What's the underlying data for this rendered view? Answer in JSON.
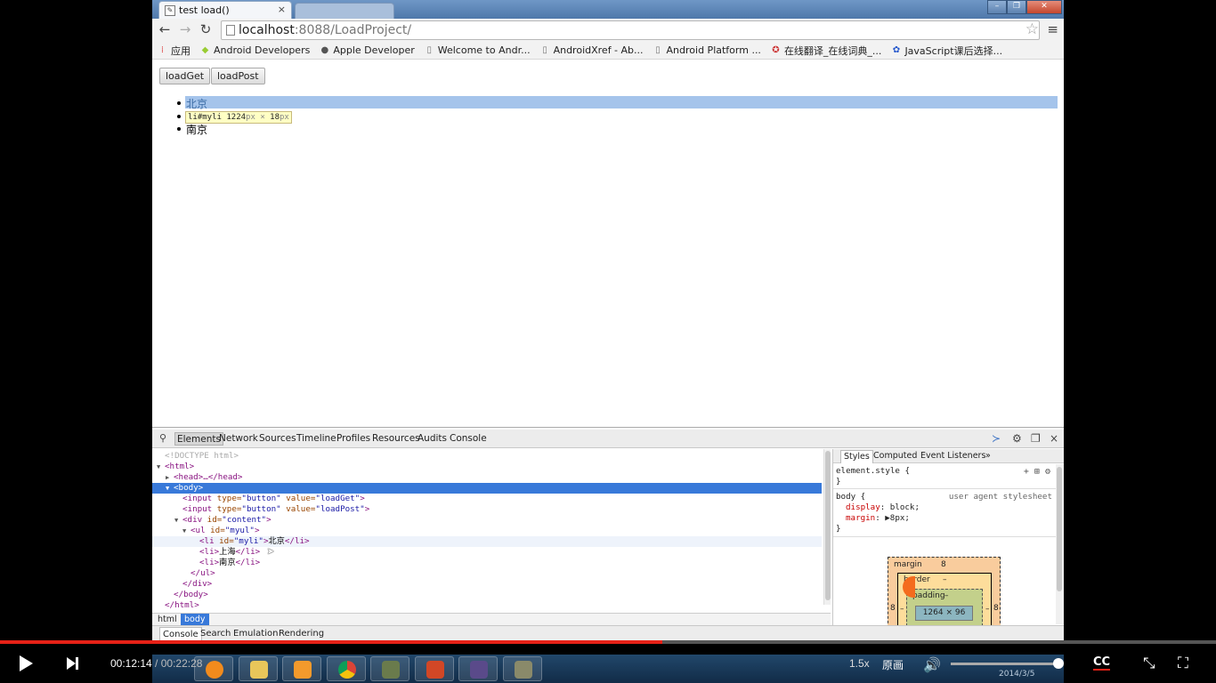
{
  "browser": {
    "tab_title": "test load()",
    "tab_close": "×",
    "window_controls": {
      "minimize": "–",
      "restore": "❐",
      "close": "✕"
    },
    "url_host": "localhost",
    "url_rest": ":8088/LoadProject/",
    "bookmarks": [
      {
        "label": "应用",
        "icon": "apps-grid-icon"
      },
      {
        "label": "Android Developers",
        "icon": "android-icon"
      },
      {
        "label": "Apple Developer",
        "icon": "apple-icon"
      },
      {
        "label": "Welcome to Andr...",
        "icon": "page-icon"
      },
      {
        "label": "AndroidXref - Ab...",
        "icon": "page-icon"
      },
      {
        "label": "Android Platform ...",
        "icon": "page-icon"
      },
      {
        "label": "在线翻译_在线词典_...",
        "icon": "translate-icon"
      },
      {
        "label": "JavaScript课后选择...",
        "icon": "baidu-icon"
      }
    ]
  },
  "page": {
    "buttons": {
      "load_get": "loadGet",
      "load_post": "loadPost"
    },
    "list_items": [
      "北京",
      "上海",
      "南京"
    ],
    "tooltip": {
      "selector": "li#myli",
      "width": "1224",
      "times": "×",
      "height": "18",
      "unit": "px"
    }
  },
  "devtools": {
    "tabs": [
      "Elements",
      "Network",
      "Sources",
      "Timeline",
      "Profiles",
      "Resources",
      "Audits",
      "Console"
    ],
    "dom_lines": [
      {
        "text": "<!DOCTYPE html>"
      },
      {
        "text": "<html>"
      },
      {
        "text": "<head>…</head>"
      },
      {
        "text": "<body>"
      },
      {
        "tag_open": "<input ",
        "a1": "type=",
        "v1": "\"button\"",
        "a2": " value=",
        "v2": "\"loadGet\"",
        "tag_close": ">"
      },
      {
        "tag_open": "<input ",
        "a1": "type=",
        "v1": "\"button\"",
        "a2": " value=",
        "v2": "\"loadPost\"",
        "tag_close": ">"
      },
      {
        "tag_open": "<div ",
        "a1": "id=",
        "v1": "\"content\"",
        "tag_close": ">"
      },
      {
        "tag_open": "<ul ",
        "a1": "id=",
        "v1": "\"myul\"",
        "tag_close": ">"
      },
      {
        "tag_open": "<li ",
        "a1": "id=",
        "v1": "\"myli\"",
        "tag_close": ">",
        "text": "北京",
        "end": "</li>"
      },
      {
        "tag_open": "<li>",
        "text": "上海",
        "end": "</li>"
      },
      {
        "tag_open": "<li>",
        "text": "南京",
        "end": "</li>"
      },
      {
        "text": "</ul>"
      },
      {
        "text": "</div>"
      },
      {
        "text": "</body>"
      },
      {
        "text": "</html>"
      }
    ],
    "breadcrumbs": [
      "html",
      "body"
    ],
    "sidebar_tabs": [
      "Styles",
      "Computed",
      "Event Listeners",
      "»"
    ],
    "styles": {
      "element_style": "element.style {",
      "close_brace": "}",
      "body_selector": "body {",
      "ua_label": "user agent stylesheet",
      "prop_display": "display",
      "val_display": ": block;",
      "prop_margin": "margin",
      "val_margin": ": ▶8px;"
    },
    "box_model": {
      "margin_label": "margin",
      "margin_value": "8",
      "border_label": "border",
      "border_value": "–",
      "padding_label": "padding",
      "padding_value": "–",
      "content_size": "1264 × 96",
      "margin_left": "8",
      "margin_right": "8",
      "border_left": "–",
      "border_right": "–"
    },
    "drawer_tabs": [
      "Console",
      "Search",
      "Emulation",
      "Rendering"
    ]
  },
  "player": {
    "current_time": "00:12:14",
    "separator": " / ",
    "duration": "00:22:28",
    "progress": 0.545,
    "speed": "1.5x",
    "quality": "原画",
    "volume": 0.95,
    "cc": "CC",
    "tray_date": "2014/3/5"
  },
  "colors": {
    "progress": "#e62117",
    "selected_row": "#3879d9",
    "highlight": "#a5c4eb"
  }
}
